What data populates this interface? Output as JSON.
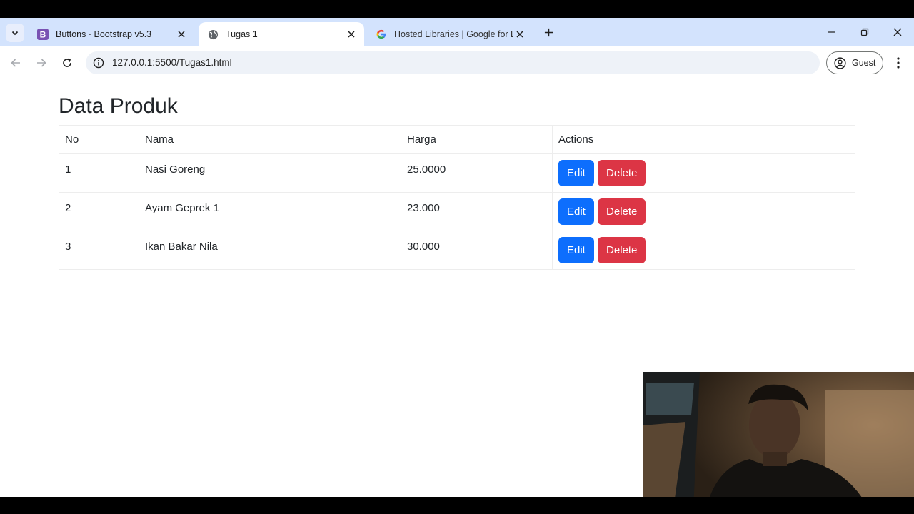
{
  "browser": {
    "tabs": [
      {
        "title": "Buttons · Bootstrap v5.3",
        "favicon": "bootstrap-icon",
        "active": false
      },
      {
        "title": "Tugas 1",
        "favicon": "globe-icon",
        "active": true
      },
      {
        "title": "Hosted Libraries  |  Google for D",
        "favicon": "google-icon",
        "active": false
      }
    ],
    "url": "127.0.0.1:5500/Tugas1.html",
    "profile_label": "Guest"
  },
  "page": {
    "title": "Data Produk",
    "table": {
      "headers": [
        "No",
        "Nama",
        "Harga",
        "Actions"
      ],
      "rows": [
        {
          "no": "1",
          "nama": "Nasi Goreng",
          "harga": "25.0000"
        },
        {
          "no": "2",
          "nama": "Ayam Geprek 1",
          "harga": "23.000"
        },
        {
          "no": "3",
          "nama": "Ikan Bakar Nila",
          "harga": "30.000"
        }
      ],
      "edit_label": "Edit",
      "delete_label": "Delete"
    }
  },
  "colors": {
    "edit_button": "#0d6efd",
    "delete_button": "#dc3545",
    "tabstrip": "#d3e3fd",
    "bootstrap_brand": "#7952b3"
  }
}
